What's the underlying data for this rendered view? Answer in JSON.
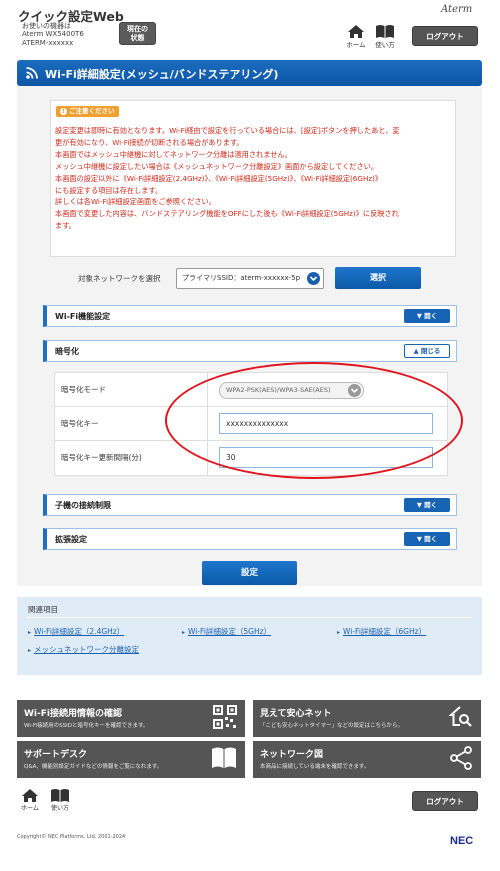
{
  "header": {
    "app_title": "クイック設定Web",
    "device_lines": [
      "お使いの機器は",
      "Aterm WX5400T6",
      "ATERM-xxxxxx"
    ],
    "status_button": [
      "現在の",
      "状態"
    ],
    "brand": "Aterm",
    "home_label": "ホーム",
    "help_label": "使い方",
    "logout_label": "ログアウト"
  },
  "page_title": "Wi-Fi詳細設定(メッシュ/バンドステアリング)",
  "caution": {
    "badge": "ご注意ください",
    "lines": [
      "設定変更は即時に有効となります。Wi-Fi経由で設定を行っている場合には、[設定]ボタンを押したあと、変",
      "更が有効になり、Wi-Fi接続が切断される場合があります。",
      "本画面ではメッシュ中継機に対してネットワーク分離は適用されません。",
      "メッシュ中継機に設定したい場合は《メッシュネットワーク分離設定》画面から設定してください。",
      "本画面の設定以外に《Wi-Fi詳細設定(2.4GHz)》、《Wi-Fi詳細設定(5GHz)》、《Wi-Fi詳細設定(6GHz)》",
      "にも設定する項目は存在します。",
      "詳しくは各Wi-Fi詳細設定画面をご参照ください。",
      "本画面で変更した内容は、バンドステアリング機能をOFFにした後も《Wi-Fi詳細設定(5GHz)》に反映され",
      "ます。"
    ]
  },
  "network_select": {
    "label": "対象ネットワークを選択",
    "value": "プライマリSSID：aterm-xxxxxx-5p",
    "button": "選択"
  },
  "sections": {
    "wifi_function": {
      "label": "Wi-Fi機能設定",
      "toggle": "開く"
    },
    "encryption": {
      "label": "暗号化",
      "toggle": "閉じる"
    },
    "client_limit": {
      "label": "子機の接続制限",
      "toggle": "開く"
    },
    "extended": {
      "label": "拡張設定",
      "toggle": "開く"
    }
  },
  "encryption_form": {
    "mode_label": "暗号化モード",
    "mode_value": "WPA2-PSK(AES)/WPA3-SAE(AES)",
    "key_label": "暗号化キー",
    "key_value": "xxxxxxxxxxxxxx",
    "interval_label": "暗号化キー更新間隔(分)",
    "interval_value": "30"
  },
  "set_button": "設定",
  "related": {
    "title": "関連項目",
    "links": [
      "Wi-Fi詳細設定（2.4GHz）",
      "Wi-Fi詳細設定（5GHz）",
      "Wi-Fi詳細設定（6GHz）",
      "メッシュネットワーク分離設定"
    ]
  },
  "tiles": [
    {
      "title": "Wi-Fi接続用情報の確認",
      "desc": "Wi-Fi接続用のSSIDと暗号化キーを確認できます。",
      "icon": "qr-code-icon"
    },
    {
      "title": "見えて安心ネット",
      "desc": "「こども安心ネットタイマー」などの設定はこちらから。",
      "icon": "home-search-icon"
    },
    {
      "title": "サポートデスク",
      "desc": "Q&A、機能別設定ガイドなどの情報をご覧になれます。",
      "icon": "book-icon"
    },
    {
      "title": "ネットワーク図",
      "desc": "本商品に接続している端末を確認できます。",
      "icon": "network-icon"
    }
  ],
  "footer": {
    "home_label": "ホーム",
    "help_label": "使い方",
    "logout_label": "ログアウト",
    "copyright": "Copyright© NEC Platforms, Ltd. 2001-2024",
    "nec_logo": "NEC"
  },
  "colors": {
    "primary": "#1763b4",
    "caution_text": "#d12a1a",
    "annotation_circle": "#e0151e",
    "tile_bg": "#555555"
  }
}
